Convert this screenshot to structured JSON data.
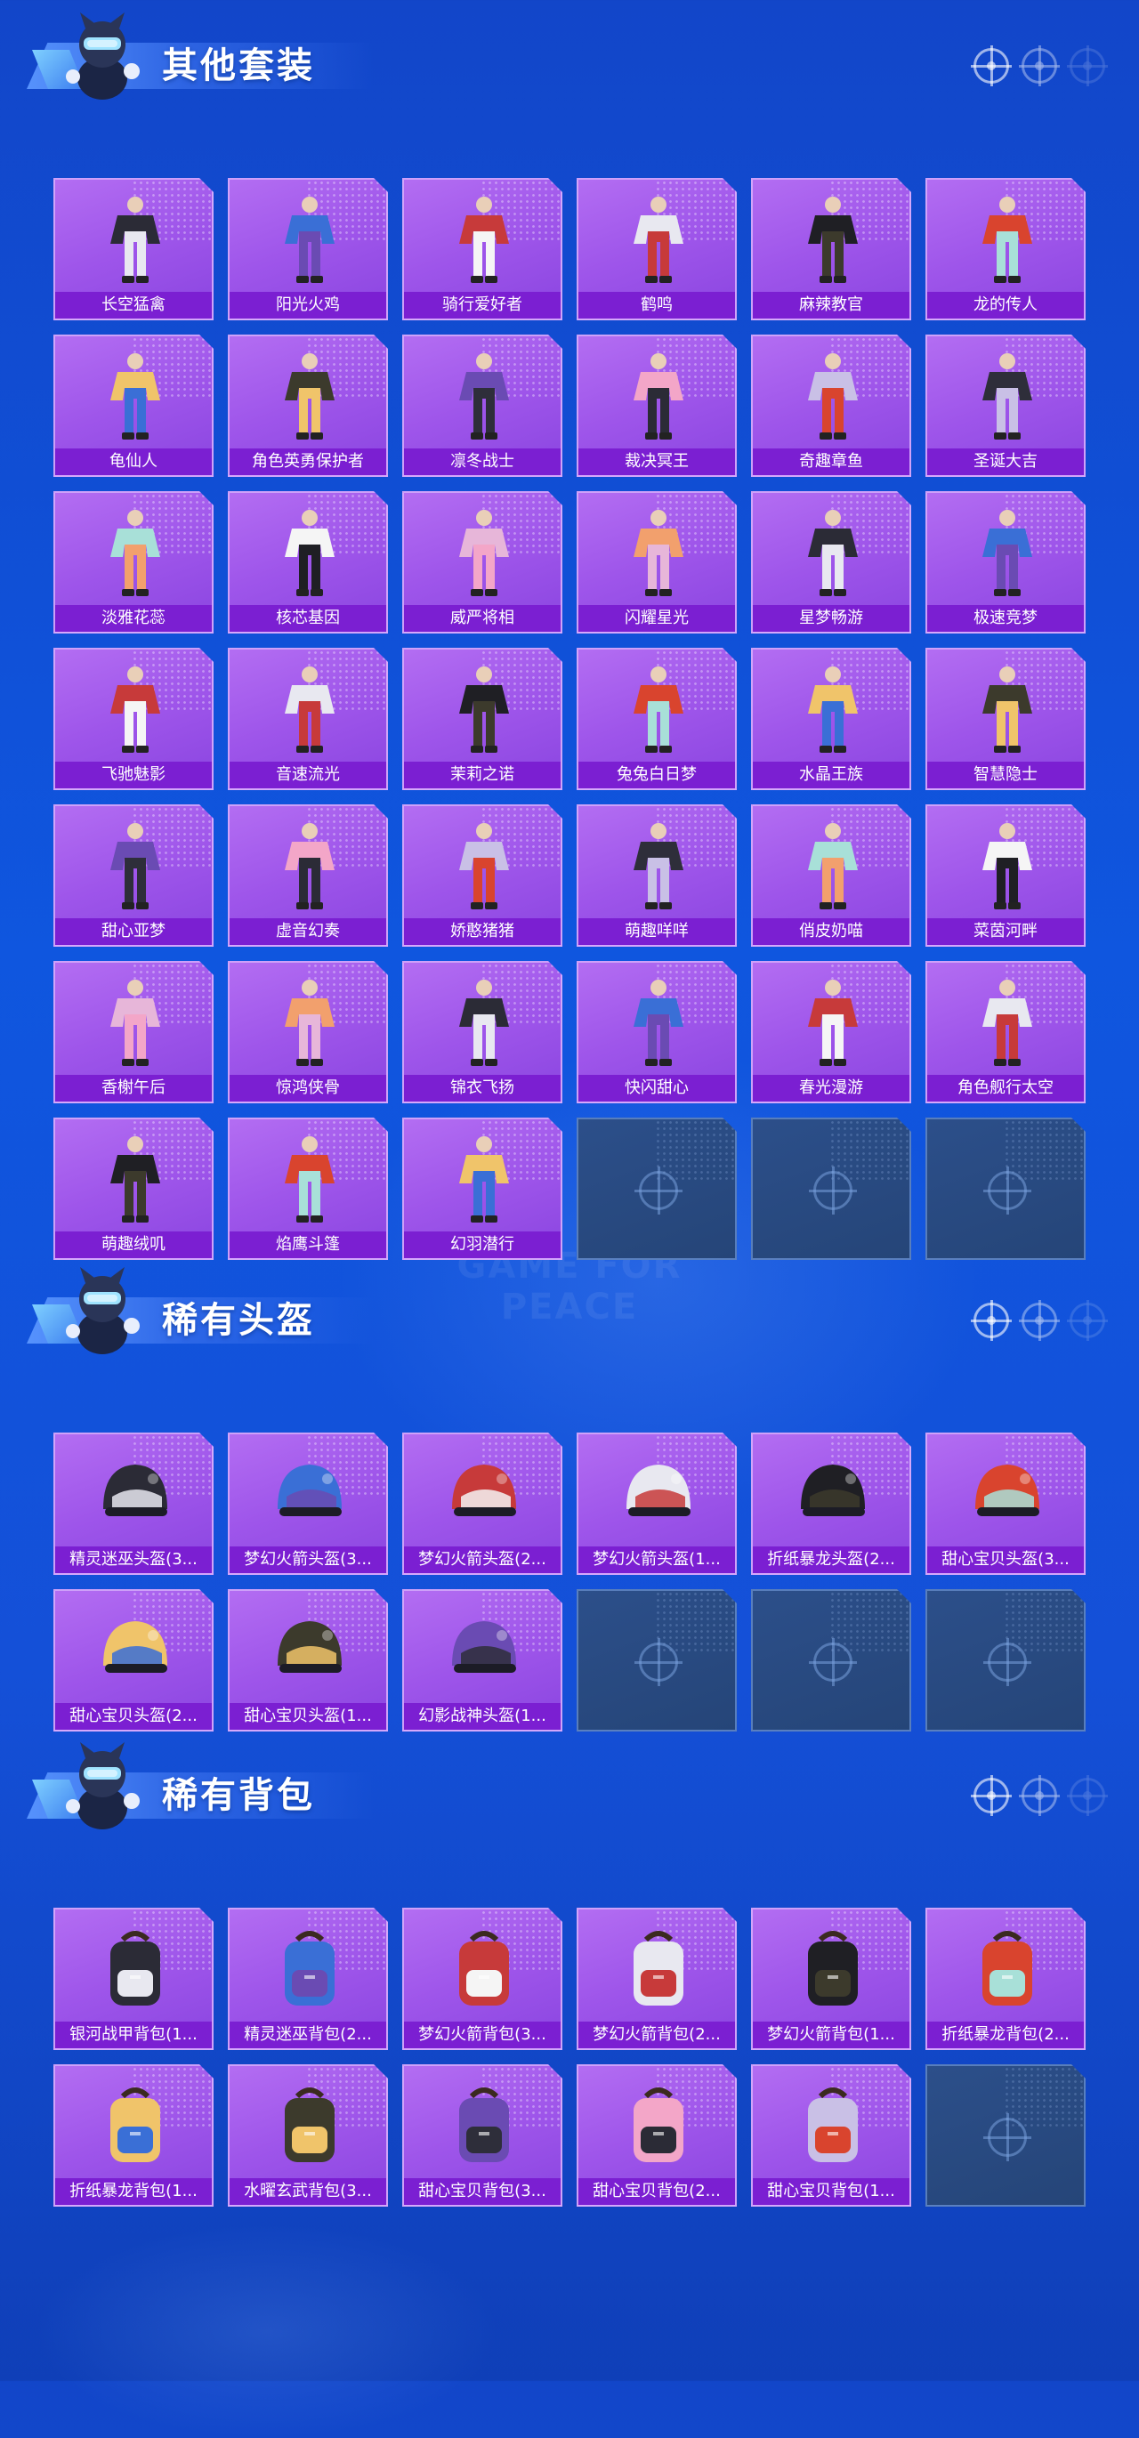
{
  "watermark": "GAME FOR PEACE",
  "sections": [
    {
      "id": "outfits",
      "title": "其他套装",
      "items": [
        "长空猛禽",
        "阳光火鸡",
        "骑行爱好者",
        "鹤鸣",
        "麻辣教官",
        "龙的传人",
        "龟仙人",
        "角色英勇保护者",
        "凛冬战士",
        "裁决冥王",
        "奇趣章鱼",
        "圣诞大吉",
        "淡雅花蕊",
        "核芯基因",
        "威严将相",
        "闪耀星光",
        "星梦畅游",
        "极速竞梦",
        "飞驰魅影",
        "音速流光",
        "茉莉之诺",
        "兔兔白日梦",
        "水晶王族",
        "智慧隐士",
        "甜心亚梦",
        "虚音幻奏",
        "娇憨猪猪",
        "萌趣咩咩",
        "俏皮奶喵",
        "菜茵河畔",
        "香榭午后",
        "惊鸿侠骨",
        "锦衣飞扬",
        "快闪甜心",
        "春光漫游",
        "角色舰行太空",
        "萌趣绒叽",
        "焰鹰斗篷",
        "幻羽潜行"
      ],
      "empty_slots": 3
    },
    {
      "id": "helmets",
      "title": "稀有头盔",
      "items": [
        "精灵迷巫头盔(3...",
        "梦幻火箭头盔(3...",
        "梦幻火箭头盔(2...",
        "梦幻火箭头盔(1...",
        "折纸暴龙头盔(2...",
        "甜心宝贝头盔(3...",
        "甜心宝贝头盔(2...",
        "甜心宝贝头盔(1...",
        "幻影战神头盔(1..."
      ],
      "empty_slots": 3
    },
    {
      "id": "backpacks",
      "title": "稀有背包",
      "items": [
        "银河战甲背包(1...",
        "精灵迷巫背包(2...",
        "梦幻火箭背包(3...",
        "梦幻火箭背包(2...",
        "梦幻火箭背包(1...",
        "折纸暴龙背包(2...",
        "折纸暴龙背包(1...",
        "水曜玄武背包(3...",
        "甜心宝贝背包(3...",
        "甜心宝贝背包(2...",
        "甜心宝贝背包(1..."
      ],
      "empty_slots": 1
    }
  ],
  "icons": {
    "header": "crosshair-icon",
    "empty": "crosshair-icon",
    "mascot": "mascot-icon"
  },
  "colors": {
    "card": "#a45ded",
    "card_label": "#7b1fd2",
    "empty_card": "#284a80",
    "page_bg": "#1450d8"
  }
}
